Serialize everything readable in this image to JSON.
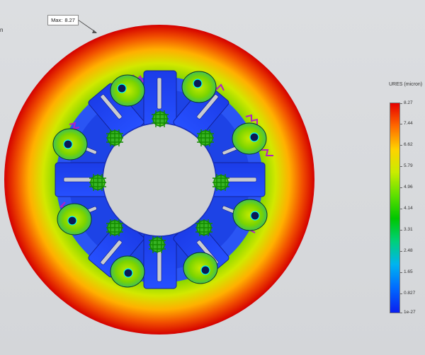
{
  "viewport": {
    "edge_label": "n",
    "max_tag": {
      "label": "Max:",
      "value": "8.27"
    }
  },
  "legend": {
    "title": "URES (micron)",
    "ticks": [
      "8.27",
      "7.44",
      "6.62",
      "5.79",
      "4.96",
      "4.14",
      "3.31",
      "2.48",
      "1.65",
      "0.827",
      "1e-27"
    ],
    "colors": {
      "max": "#e60000",
      "mid": "#00c600",
      "min": "#0a1ff0"
    }
  },
  "icons": [
    "pointer-arrow-icon"
  ]
}
